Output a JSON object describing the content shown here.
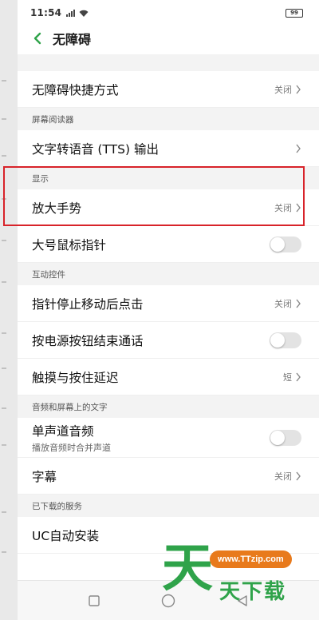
{
  "status": {
    "time": "11:54",
    "battery": "99"
  },
  "header": {
    "title": "无障碍"
  },
  "rows": {
    "shortcut": {
      "label": "无障碍快捷方式",
      "value": "关闭"
    },
    "tts": {
      "label": "文字转语音 (TTS) 输出"
    },
    "magnify": {
      "label": "放大手势",
      "value": "关闭"
    },
    "big_cursor": {
      "label": "大号鼠标指针",
      "toggle": "off"
    },
    "click_after_stop": {
      "label": "指针停止移动后点击",
      "value": "关闭"
    },
    "power_end_call": {
      "label": "按电源按钮结束通话",
      "toggle": "off"
    },
    "touch_hold_delay": {
      "label": "触摸与按住延迟",
      "value": "短"
    },
    "mono_audio": {
      "label": "单声道音频",
      "sub": "播放音频时合并声道",
      "toggle": "off"
    },
    "captions": {
      "label": "字幕",
      "value": "关闭"
    },
    "uc_install": {
      "label": "UC自动安装"
    }
  },
  "sections": {
    "screen_reader": "屏幕阅读器",
    "display": "显示",
    "interaction": "互动控件",
    "audio_text": "音频和屏幕上的文字",
    "downloaded": "已下载的服务"
  },
  "watermark": {
    "big": "天",
    "url": "www.TTzip.com",
    "small": "天下载"
  },
  "colors": {
    "accent_green": "#2fa34a",
    "highlight_red": "#d8232a",
    "watermark_orange": "#e87a1c"
  },
  "icons": {
    "back": "chevron-left-icon",
    "row_arrow": "chevron-right-icon",
    "nav_recent": "square-icon",
    "nav_home": "circle-icon",
    "nav_back": "triangle-icon"
  }
}
